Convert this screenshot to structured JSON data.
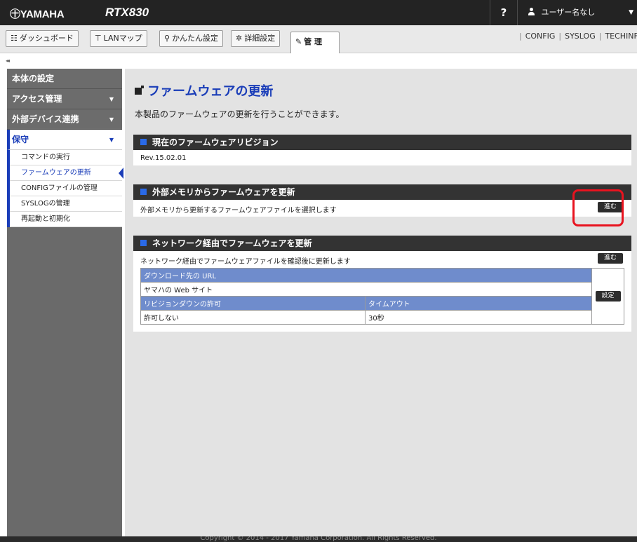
{
  "header": {
    "logo": "㊉YAMAHA",
    "model": "RTX830",
    "help": "?",
    "user": "ユーザー名なし"
  },
  "tabs": [
    {
      "label": "ダッシュボード",
      "icon": "dashboard-icon",
      "glyph": "☷"
    },
    {
      "label": "LANマップ",
      "icon": "lan-map-icon",
      "glyph": "⊤"
    },
    {
      "label": "かんたん設定",
      "icon": "wizard-icon",
      "glyph": "⚲"
    },
    {
      "label": "詳細設定",
      "icon": "gear-icon",
      "glyph": "✲"
    },
    {
      "label": "管 理",
      "icon": "wrench-icon",
      "glyph": "🔧"
    }
  ],
  "toplinks": [
    "CONFIG",
    "SYSLOG",
    "TECHINFO"
  ],
  "collapse": "◂◂",
  "sidebar": {
    "groups": [
      {
        "label": "本体の設定",
        "arrow": ""
      },
      {
        "label": "アクセス管理",
        "arrow": "▼"
      },
      {
        "label": "外部デバイス連携",
        "arrow": "▼"
      },
      {
        "label": "保守",
        "arrow": "▼"
      }
    ],
    "items": [
      {
        "label": "コマンドの実行"
      },
      {
        "label": "ファームウェアの更新"
      },
      {
        "label": "CONFIGファイルの管理"
      },
      {
        "label": "SYSLOGの管理"
      },
      {
        "label": "再起動と初期化"
      }
    ]
  },
  "main": {
    "title": "ファームウェアの更新",
    "description": "本製品のファームウェアの更新を行うことができます。",
    "sections": {
      "current": {
        "title": "現在のファームウェアリビジョン",
        "revision": "Rev.15.02.01"
      },
      "external": {
        "title": "外部メモリからファームウェアを更新",
        "text": "外部メモリから更新するファームウェアファイルを選択します",
        "button": "進む"
      },
      "network": {
        "title": "ネットワーク経由でファームウェアを更新",
        "text": "ネットワーク経由でファームウェアファイルを確認後に更新します",
        "button": "進む",
        "url_label": "ダウンロード先の URL",
        "url_value": "ヤマハの Web サイト",
        "revdown_label": "リビジョンダウンの許可",
        "revdown_value": "許可しない",
        "timeout_label": "タイムアウト",
        "timeout_value": "30秒",
        "set_button": "設定"
      }
    }
  },
  "footer": "Copyright © 2014 - 2017 Yamaha Corporation. All Rights Reserved."
}
